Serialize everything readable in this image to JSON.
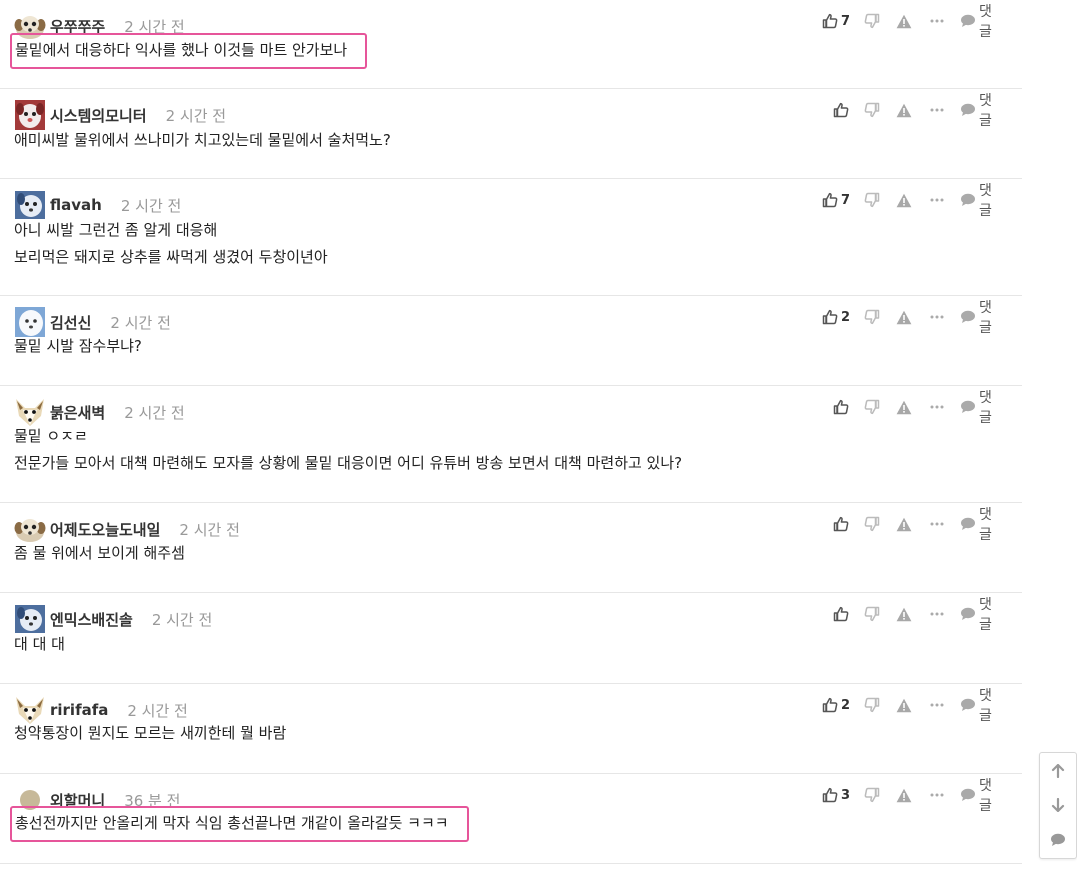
{
  "comments": [
    {
      "author": "우쭈쭈주",
      "time": "2 시간 전",
      "likes": "7",
      "reply_label": "댓글",
      "avatar": "sheepdog",
      "highlight": true,
      "lines": [
        "물밑에서 대응하다 익사를 했나 이것들 마트 안가보나"
      ]
    },
    {
      "author": "시스템의모니터",
      "time": "2 시간 전",
      "likes": "",
      "reply_label": "댓글",
      "avatar": "red-dog",
      "highlight": false,
      "lines": [
        "애미씨발 물위에서 쓰나미가 치고있는데 물밑에서 술처먹노?"
      ]
    },
    {
      "author": "flavah",
      "time": "2 시간 전",
      "likes": "7",
      "reply_label": "댓글",
      "avatar": "blue-dog",
      "highlight": false,
      "lines": [
        "아니 씨발 그런건 좀 알게 대응해",
        "보리먹은 돼지로 상추를 싸먹게 생겼어 두창이년아"
      ]
    },
    {
      "author": "김선신",
      "time": "2 시간 전",
      "likes": "2",
      "reply_label": "댓글",
      "avatar": "white-dog",
      "highlight": false,
      "lines": [
        "물밑 시발 잠수부냐?"
      ]
    },
    {
      "author": "붉은새벽",
      "time": "2 시간 전",
      "likes": "",
      "reply_label": "댓글",
      "avatar": "fox",
      "highlight": false,
      "lines": [
        "물밑 ㅇㅈㄹ",
        "전문가들 모아서 대책 마련해도 모자를 상황에 물밑 대응이면 어디 유튜버 방송 보면서 대책 마련하고 있나?"
      ]
    },
    {
      "author": "어제도오늘도내일",
      "time": "2 시간 전",
      "likes": "",
      "reply_label": "댓글",
      "avatar": "sheepdog",
      "highlight": false,
      "lines": [
        "좀 물 위에서 보이게 해주셈"
      ]
    },
    {
      "author": "엔믹스배진솔",
      "time": "2 시간 전",
      "likes": "",
      "reply_label": "댓글",
      "avatar": "blue-dog",
      "highlight": false,
      "lines": [
        "대 대 대"
      ]
    },
    {
      "author": "ririfafa",
      "time": "2 시간 전",
      "likes": "2",
      "reply_label": "댓글",
      "avatar": "fox",
      "highlight": false,
      "lines": [
        "청약통장이 뭔지도 모르는 새끼한테 뭘 바람"
      ]
    },
    {
      "author": "외할머니",
      "time": "36 분 전",
      "likes": "3",
      "reply_label": "댓글",
      "avatar": "default-circle",
      "highlight": true,
      "lines": [
        "총선전까지만 안올리게 막자 식임 총선끝나면 개같이 올라갈듯 ㅋㅋㅋ"
      ]
    }
  ],
  "colors": {
    "highlight_border": "#e6559a",
    "icon": "#9a9a9a",
    "author": "#333333",
    "time": "#999999",
    "divider": "#e6e6e6"
  },
  "icons": {
    "like": "thumbs-up-icon",
    "dislike": "thumbs-down-icon",
    "report": "warning-icon",
    "more": "more-dots-icon",
    "reply": "speech-bubble-icon"
  },
  "side_nav": [
    {
      "name": "scroll-up",
      "icon": "arrow-up-icon"
    },
    {
      "name": "scroll-down",
      "icon": "arrow-down-icon"
    },
    {
      "name": "comments",
      "icon": "speech-bubble-icon"
    }
  ]
}
